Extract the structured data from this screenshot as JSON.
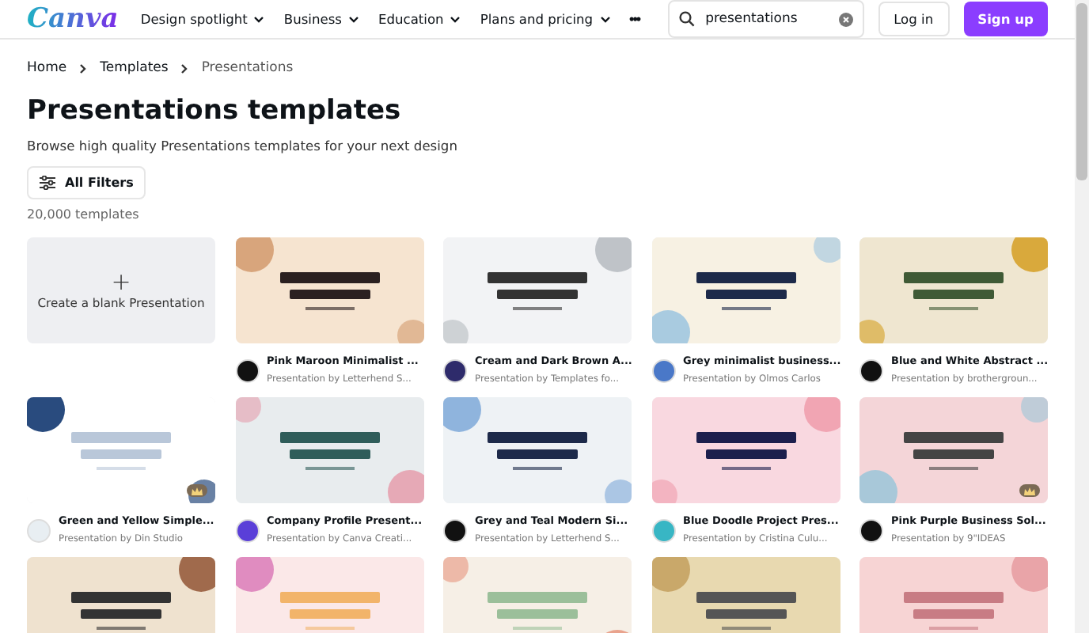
{
  "header": {
    "logo": "Canva",
    "nav": [
      {
        "label": "Design spotlight",
        "dropdown": true
      },
      {
        "label": "Business",
        "dropdown": true
      },
      {
        "label": "Education",
        "dropdown": true
      },
      {
        "label": "Plans and pricing",
        "dropdown": true
      }
    ],
    "more": "•••",
    "search": {
      "value": "presentations"
    },
    "login": "Log in",
    "signup": "Sign up"
  },
  "breadcrumb": [
    "Home",
    "Templates",
    "Presentations"
  ],
  "title": "Presentations templates",
  "subtitle": "Browse high quality Presentations templates for your next design",
  "filters": "All Filters",
  "count": "20,000 templates",
  "cards": [
    {
      "kind": "blank",
      "icon": "+",
      "label": "Create a blank Presentation"
    },
    {
      "kind": "template",
      "title": "Pink Maroon Minimalist ...",
      "author": "Presentation by Letterhend S...",
      "premium": false,
      "color": "#111111"
    },
    {
      "kind": "template",
      "title": "Cream and Dark Brown A...",
      "author": "Presentation by Templates fo...",
      "premium": false,
      "color": "#2e2b6b"
    },
    {
      "kind": "template",
      "title": "Grey minimalist business...",
      "author": "Presentation by Olmos Carlos",
      "premium": false,
      "color": "#4a78c8"
    },
    {
      "kind": "template",
      "title": "Blue and White Abstract ...",
      "author": "Presentation by brothergroun...",
      "premium": false,
      "color": "#111111"
    },
    {
      "kind": "template",
      "title": "Green and Yellow Simple...",
      "author": "Presentation by Din Studio",
      "premium": true,
      "color": "#e8eef2"
    },
    {
      "kind": "template",
      "title": "Company Profile Present...",
      "author": "Presentation by Canva Creati...",
      "premium": false,
      "color": "#5a3fd8"
    },
    {
      "kind": "template",
      "title": "Grey and Teal Modern Si...",
      "author": "Presentation by Letterhend S...",
      "premium": false,
      "color": "#111111"
    },
    {
      "kind": "template",
      "title": "Blue Doodle Project Pres...",
      "author": "Presentation by Cristina Culu...",
      "premium": false,
      "color": "#38b6c4"
    },
    {
      "kind": "template",
      "title": "Pink Purple Business Sol...",
      "author": "Presentation by 9\"IDEAS",
      "premium": true,
      "color": "#111111"
    },
    {
      "kind": "partial"
    },
    {
      "kind": "partial"
    },
    {
      "kind": "partial"
    },
    {
      "kind": "partial"
    },
    {
      "kind": "partial"
    }
  ]
}
